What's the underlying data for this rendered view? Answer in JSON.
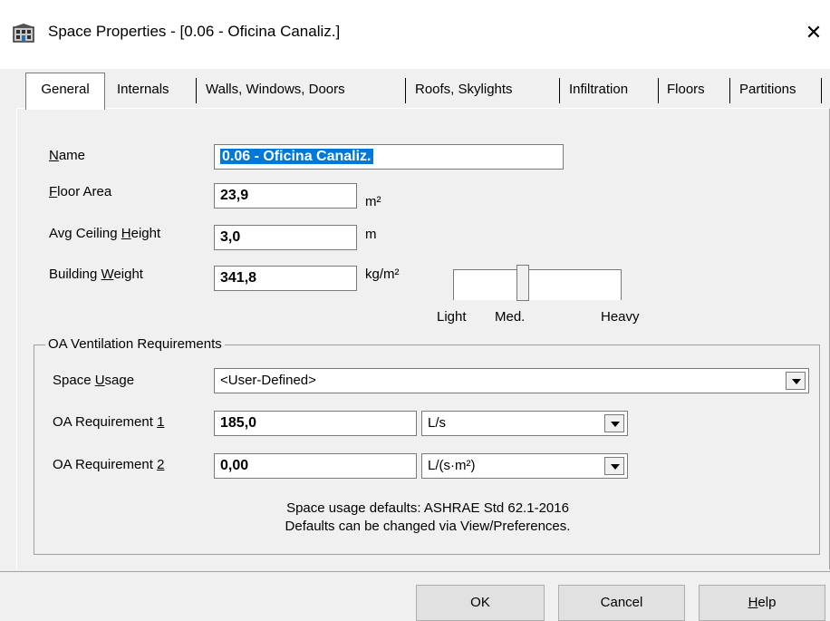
{
  "window": {
    "title": "Space Properties - [0.06 - Oficina Canaliz.]",
    "close_glyph": "✕",
    "app_icon": "building-icon"
  },
  "tabs": [
    {
      "label": "General",
      "active": true
    },
    {
      "label": "Internals"
    },
    {
      "label": "Walls, Windows, Doors"
    },
    {
      "label": "Roofs, Skylights"
    },
    {
      "label": "Infiltration"
    },
    {
      "label": "Floors"
    },
    {
      "label": "Partitions"
    }
  ],
  "general": {
    "name": {
      "label_pre": "",
      "label_u": "N",
      "label_post": "ame",
      "value": "0.06 - Oficina Canaliz."
    },
    "floor_area": {
      "label_u": "F",
      "label_post": "loor Area",
      "value": "23,9",
      "unit": "m²"
    },
    "ceiling_height": {
      "label_pre": "Avg Ceiling ",
      "label_u": "H",
      "label_post": "eight",
      "value": "3,0",
      "unit": "m"
    },
    "building_weight": {
      "label_pre": "Building ",
      "label_u": "W",
      "label_post": "eight",
      "value": "341,8",
      "unit": "kg/m²"
    },
    "weight_slider": {
      "labels": [
        "Light",
        "Med.",
        "Heavy"
      ]
    }
  },
  "oa": {
    "group_title": "OA Ventilation Requirements",
    "space_usage": {
      "label_pre": "Space ",
      "label_u": "U",
      "label_post": "sage",
      "value": "<User-Defined>"
    },
    "req1": {
      "label_pre": "OA Requirement ",
      "label_u": "1",
      "value": "185,0",
      "unit": "L/s"
    },
    "req2": {
      "label_pre": "OA Requirement ",
      "label_u": "2",
      "value": "0,00",
      "unit": "L/(s·m²)"
    },
    "note_line1": "Space usage defaults: ASHRAE Std 62.1-2016",
    "note_line2": "Defaults can be changed via View/Preferences."
  },
  "buttons": {
    "ok": "OK",
    "cancel": "Cancel",
    "help_u": "H",
    "help_post": "elp"
  }
}
